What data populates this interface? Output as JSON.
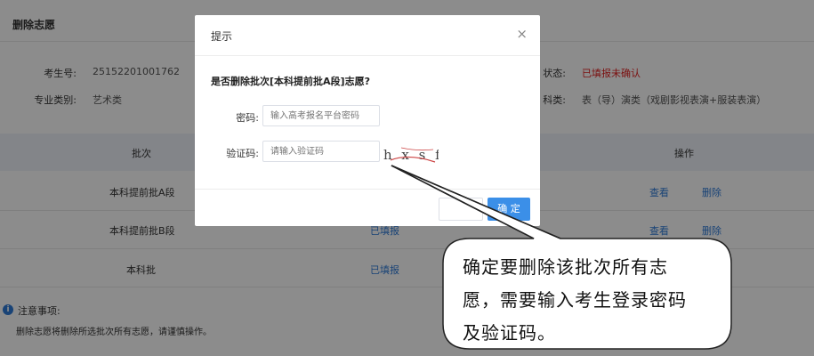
{
  "page": {
    "title": "删除志愿",
    "info": {
      "exam_no_label": "考生号:",
      "exam_no_value": "25152201001762",
      "category_label": "专业类别:",
      "category_value": "艺术类",
      "status_label": "状态:",
      "status_value": "已填报未确认",
      "subject_label": "科类:",
      "subject_value": "表（导）演类（戏剧影视表演+服装表演）"
    },
    "table": {
      "headers": [
        "批次",
        "操作"
      ],
      "rows": [
        {
          "batch": "本科提前批A段",
          "state": "",
          "view": "查看",
          "delete": "删除"
        },
        {
          "batch": "本科提前批B段",
          "state": "已填报",
          "view": "查看",
          "delete": "删除"
        },
        {
          "batch": "本科批",
          "state": "已填报",
          "view": "",
          "delete": ""
        }
      ]
    },
    "notice": {
      "icon": "info-icon",
      "title": "注意事项:",
      "text": "删除志愿将删除所选批次所有志愿，请谨慎操作。"
    }
  },
  "modal": {
    "title": "提示",
    "close": "×",
    "question": "是否删除批次[本科提前批A段]志愿?",
    "password_label": "密码:",
    "password_placeholder": "输入高考报名平台密码",
    "captcha_label": "验证码:",
    "captcha_placeholder": "请输入验证码",
    "captcha_text": "h x s f",
    "ok_label": "确 定"
  },
  "callout": {
    "line1": "确定要删除该批次所有志",
    "line2": "愿，需要输入考生登录密码",
    "line3": "及验证码。"
  },
  "colors": {
    "accent": "#3b8fe8",
    "link": "#2f7bd8",
    "warning": "#e02020",
    "table_header": "#eef2f9"
  }
}
